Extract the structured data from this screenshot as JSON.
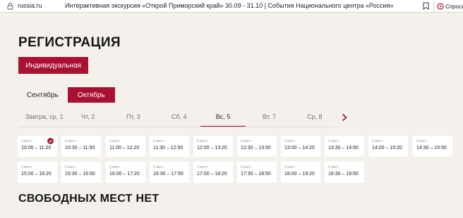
{
  "browser": {
    "url": "russia.ru",
    "title": "Интерактивная экскурсия «Открой Приморский край» 30.09 - 31.10 | События Национального центра «Россия»",
    "ask_label": "Спроси"
  },
  "registration": {
    "heading": "РЕГИСТРАЦИЯ",
    "type_button": "Индивидуальная"
  },
  "months": [
    {
      "label": "Сентябрь",
      "active": false
    },
    {
      "label": "Октябрь",
      "active": true
    }
  ],
  "days": [
    {
      "label": "Завтра, ср, 1",
      "active": false
    },
    {
      "label": "Чт, 2",
      "active": false
    },
    {
      "label": "Пт, 3",
      "active": false
    },
    {
      "label": "Сб, 4",
      "active": false
    },
    {
      "label": "Вс, 5",
      "active": true
    },
    {
      "label": "Вт, 7",
      "active": false
    },
    {
      "label": "Ср, 8",
      "active": false
    }
  ],
  "slots": [
    {
      "seats": "0 мест",
      "time": "10:00 – 11:20",
      "selected": true
    },
    {
      "seats": "0 мест",
      "time": "10:30 – 11:50",
      "selected": false
    },
    {
      "seats": "0 мест",
      "time": "11:00 – 12:20",
      "selected": false
    },
    {
      "seats": "0 мест",
      "time": "11:30 – 12:50",
      "selected": false
    },
    {
      "seats": "0 мест",
      "time": "12:00 – 13:20",
      "selected": false
    },
    {
      "seats": "0 мест",
      "time": "12:30 – 13:50",
      "selected": false
    },
    {
      "seats": "0 мест",
      "time": "13:00 – 14:20",
      "selected": false
    },
    {
      "seats": "0 мест",
      "time": "13:30 – 14:50",
      "selected": false
    },
    {
      "seats": "0 мест",
      "time": "14:00 – 15:20",
      "selected": false
    },
    {
      "seats": "0 мест",
      "time": "14:30 – 15:50",
      "selected": false
    },
    {
      "seats": "0 мест",
      "time": "15:00 – 16:20",
      "selected": false
    },
    {
      "seats": "0 мест",
      "time": "15:30 – 16:50",
      "selected": false
    },
    {
      "seats": "0 мест",
      "time": "16:00 – 17:20",
      "selected": false
    },
    {
      "seats": "0 мест",
      "time": "16:30 – 17:50",
      "selected": false
    },
    {
      "seats": "0 мест",
      "time": "17:00 – 18:20",
      "selected": false
    },
    {
      "seats": "0 мест",
      "time": "17:30 – 18:50",
      "selected": false
    },
    {
      "seats": "0 мест",
      "time": "18:00 – 19:20",
      "selected": false
    },
    {
      "seats": "0 мест",
      "time": "18:30 – 19:50",
      "selected": false
    }
  ],
  "status": {
    "no_seats": "СВОБОДНЫХ МЕСТ НЕТ"
  },
  "colors": {
    "accent": "#a81131",
    "background": "#f4f1ed",
    "card": "#ffffff"
  },
  "icons": {
    "lock": "lock-icon",
    "bookmark": "bookmark-icon",
    "ask": "chat-icon",
    "next": "chevron-right-icon",
    "selected": "check-icon"
  }
}
